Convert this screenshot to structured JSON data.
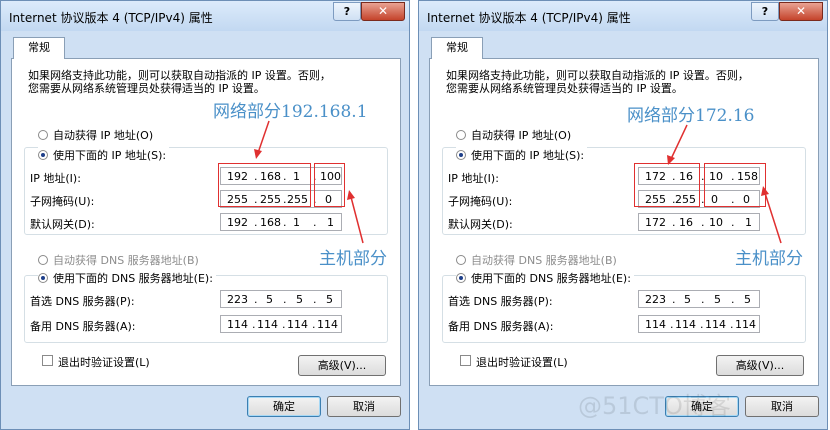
{
  "left": {
    "title": "Internet 协议版本 4 (TCP/IPv4) 属性",
    "help_label": "?",
    "close_label": "✕",
    "tab_label": "常规",
    "intro_line1": "如果网络支持此功能，则可以获取自动指派的 IP 设置。否则，",
    "intro_line2": "您需要从网络系统管理员处获得适当的 IP 设置。",
    "auto_ip_label": "自动获得 IP 地址(O)",
    "use_ip_label": "使用下面的 IP 地址(S):",
    "ip_label": "IP 地址(I):",
    "mask_label": "子网掩码(U):",
    "gateway_label": "默认网关(D):",
    "ip": [
      "192",
      "168",
      "1",
      "100"
    ],
    "mask": [
      "255",
      "255",
      "255",
      "0"
    ],
    "gateway": [
      "192",
      "168",
      "1",
      "1"
    ],
    "auto_dns_label": "自动获得 DNS 服务器地址(B)",
    "use_dns_label": "使用下面的 DNS 服务器地址(E):",
    "dns1_label": "首选 DNS 服务器(P):",
    "dns2_label": "备用 DNS 服务器(A):",
    "dns1": [
      "223",
      "5",
      "5",
      "5"
    ],
    "dns2": [
      "114",
      "114",
      "114",
      "114"
    ],
    "validate_label": "退出时验证设置(L)",
    "advanced_label": "高级(V)...",
    "ok_label": "确定",
    "cancel_label": "取消",
    "annotation_network": "网络部分192.168.1",
    "annotation_host": "主机部分"
  },
  "right": {
    "title": "Internet 协议版本 4 (TCP/IPv4) 属性",
    "help_label": "?",
    "close_label": "✕",
    "tab_label": "常规",
    "intro_line1": "如果网络支持此功能，则可以获取自动指派的 IP 设置。否则，",
    "intro_line2": "您需要从网络系统管理员处获得适当的 IP 设置。",
    "auto_ip_label": "自动获得 IP 地址(O)",
    "use_ip_label": "使用下面的 IP 地址(S):",
    "ip_label": "IP 地址(I):",
    "mask_label": "子网掩码(U):",
    "gateway_label": "默认网关(D):",
    "ip": [
      "172",
      "16",
      "10",
      "158"
    ],
    "mask": [
      "255",
      "255",
      "0",
      "0"
    ],
    "gateway": [
      "172",
      "16",
      "10",
      "1"
    ],
    "auto_dns_label": "自动获得 DNS 服务器地址(B)",
    "use_dns_label": "使用下面的 DNS 服务器地址(E):",
    "dns1_label": "首选 DNS 服务器(P):",
    "dns2_label": "备用 DNS 服务器(A):",
    "dns1": [
      "223",
      "5",
      "5",
      "5"
    ],
    "dns2": [
      "114",
      "114",
      "114",
      "114"
    ],
    "validate_label": "退出时验证设置(L)",
    "advanced_label": "高级(V)...",
    "ok_label": "确定",
    "cancel_label": "取消",
    "annotation_network": "网络部分172.16",
    "annotation_host": "主机部分"
  },
  "watermark": "@51CTO博客",
  "colors": {
    "annotation": "#4a90c8",
    "highlight_box": "#e03030",
    "frame": "#cfe0f3",
    "close_button": "#c4432b"
  }
}
